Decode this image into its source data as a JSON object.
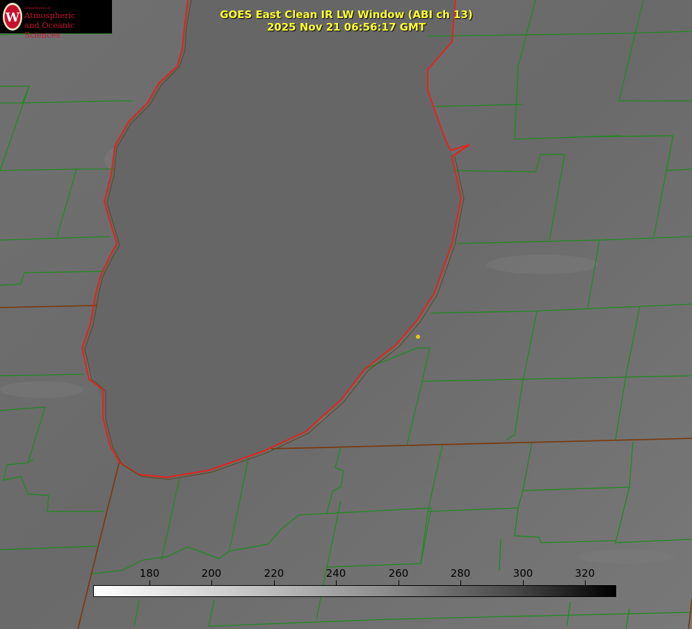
{
  "logo": {
    "department": "Department of",
    "line1": "Atmospheric",
    "line2": "and Oceanic Sciences",
    "emblem": "W"
  },
  "title": {
    "line1": "GOES East Clean IR LW Window (ABI ch 13)",
    "line2": "2025 Nov 21 06:56:17 GMT"
  },
  "colorbar": {
    "ticks": [
      "180",
      "200",
      "220",
      "240",
      "260",
      "280",
      "300",
      "320"
    ],
    "colors": {
      "low": "#ffffff",
      "high": "#000000"
    }
  },
  "colors": {
    "lake_outline": "#e8211b",
    "county_lines": "#1f8a1f",
    "state_lines": "#7a3a10",
    "marker": "#e6c619",
    "title_text": "#ffff33"
  }
}
